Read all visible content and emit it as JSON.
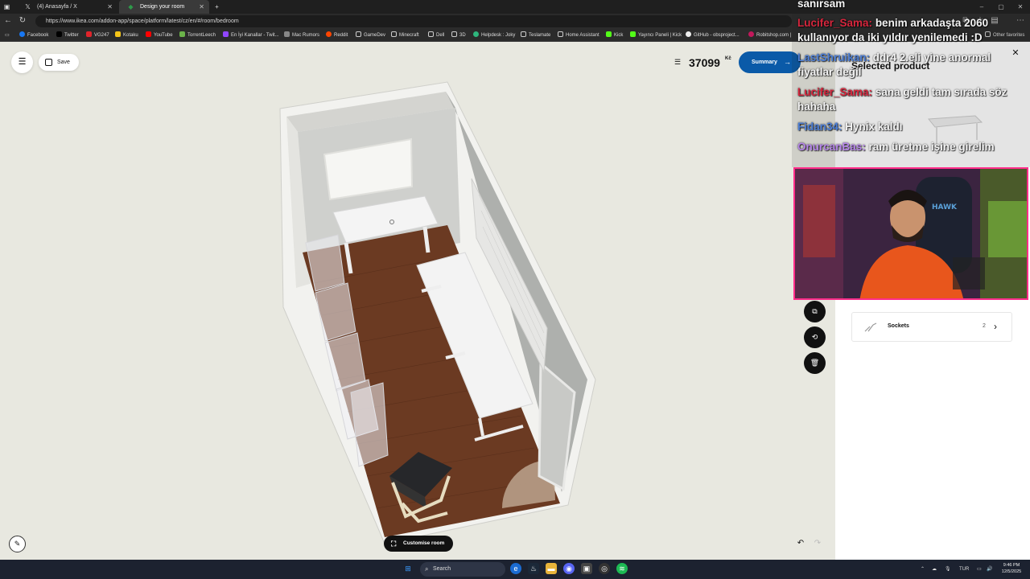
{
  "browser": {
    "tabs": [
      {
        "label": "(4) Anasayfa / X",
        "icon": "x-logo-icon"
      },
      {
        "label": "Design your room",
        "icon": "ikea-icon"
      }
    ],
    "new_tab": "+",
    "url": "https://www.ikea.com/addon-app/space/platform/latest/cz/en/#/room/bedroom",
    "bookmarks": [
      "Facebook",
      "Twitter",
      "VG247",
      "Kotaku",
      "YouTube",
      "TorrentLeech",
      "En İyi Kanallar - Twit...",
      "Mac Rumors",
      "Reddit",
      "GameDev",
      "Minecraft",
      "Dell",
      "3D",
      "Helpdesk : Joky",
      "Teslamate",
      "Home Assistant",
      "Kick",
      "Yayıncı Paneli | Kick",
      "GitHub - obsproject...",
      "Robitshop.com |"
    ],
    "other_favorites": "Other favorites",
    "window_controls": [
      "–",
      "▢",
      "✕"
    ]
  },
  "app": {
    "save_label": "Save",
    "price": "37099",
    "currency": "Kč",
    "summary_label": "Summary",
    "customise_label": "Customise room",
    "panel": {
      "title": "Selected product",
      "sockets_label": "Sockets",
      "sockets_count": "2"
    }
  },
  "chat": {
    "messages": [
      {
        "user": "",
        "text": "sanırsam"
      },
      {
        "user": "Lucifer_Sama:",
        "text": "benim arkadaşta 2060"
      },
      {
        "user": "",
        "text": "kullanıyor da iki yıldır yenilemedi :D"
      },
      {
        "user": "LastShruikan:",
        "text": "ddr4 2.eli yine anormal"
      },
      {
        "user": "",
        "text": "fiyatlar değil"
      },
      {
        "user": "Lucifer_Sama:",
        "text": "sana geldi tam sırada söz"
      },
      {
        "user": "",
        "text": "hahaha"
      },
      {
        "user": "Fidan34:",
        "text": "Hynix kaldı"
      },
      {
        "user": "OnurcanBas:",
        "text": "ram üretme işine girelim"
      }
    ]
  },
  "taskbar": {
    "search_placeholder": "Search",
    "lang": "TUR",
    "time": "9:46 PM",
    "date": "12/5/2025"
  },
  "colors": {
    "ikea_blue": "#0a5aa8",
    "canvas_bg": "#e8e8e0",
    "chat_red": "#d7263d",
    "chat_blue": "#4d7fd6",
    "webcam_border": "#ff2d8a"
  }
}
